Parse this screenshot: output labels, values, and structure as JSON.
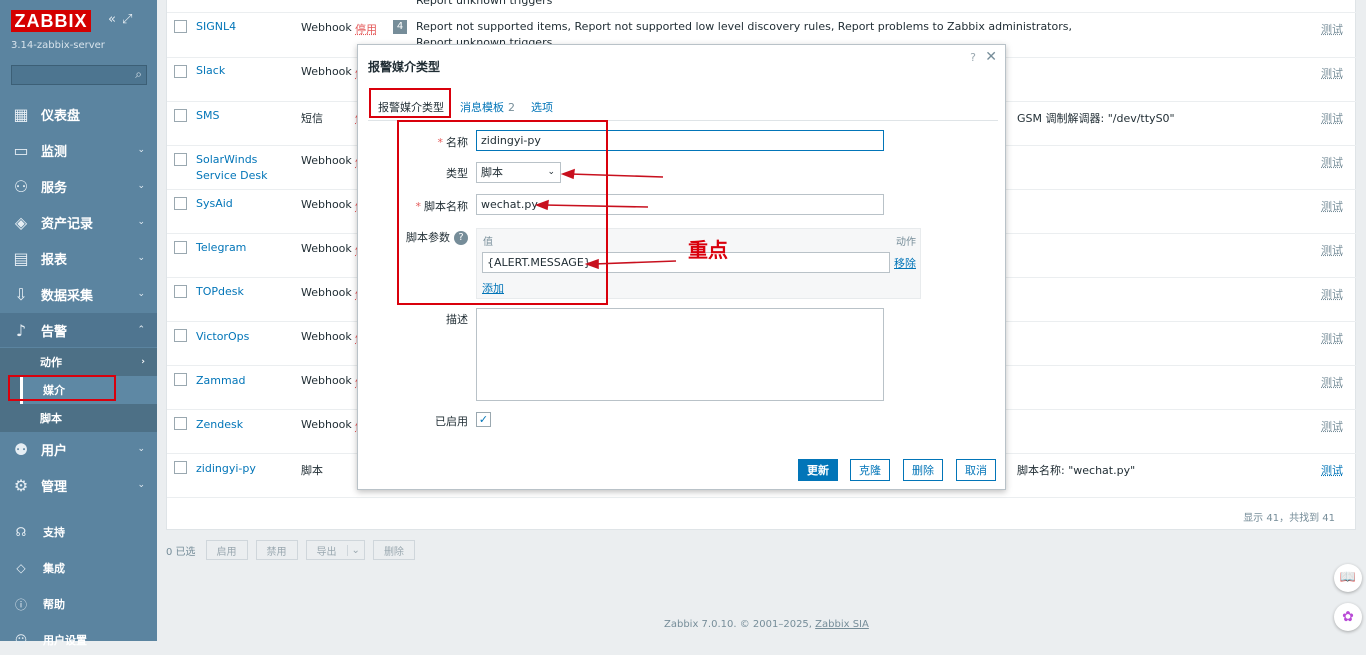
{
  "sidebar": {
    "logo": "ZABBIX",
    "server": "3.14-zabbix-server",
    "search_placeholder": "",
    "nav": [
      {
        "label": "仪表盘",
        "icon": "dashboard-icon"
      },
      {
        "label": "监测",
        "icon": "monitoring-icon"
      },
      {
        "label": "服务",
        "icon": "services-icon"
      },
      {
        "label": "资产记录",
        "icon": "inventory-icon"
      },
      {
        "label": "报表",
        "icon": "reports-icon"
      },
      {
        "label": "数据采集",
        "icon": "data-collection-icon"
      },
      {
        "label": "告警",
        "icon": "bell-icon"
      }
    ],
    "sub": [
      {
        "label": "动作"
      },
      {
        "label": "媒介"
      },
      {
        "label": "脚本"
      }
    ],
    "nav2": [
      {
        "label": "用户",
        "icon": "users-icon"
      },
      {
        "label": "管理",
        "icon": "gear-icon"
      }
    ],
    "bottom": [
      {
        "label": "支持",
        "icon": "headset-icon"
      },
      {
        "label": "集成",
        "icon": "integrations-icon"
      },
      {
        "label": "帮助",
        "icon": "help-icon"
      },
      {
        "label": "用户设置",
        "icon": "user-settings-icon"
      }
    ]
  },
  "table": {
    "top_text_line1": "Report unknown triggers",
    "rows": [
      {
        "name": "SIGNL4",
        "type": "Webhook",
        "status": "停用",
        "badge": "4",
        "actions": "Report not supported items, Report not supported low level discovery rules, Report problems to Zabbix administrators,",
        "actions2": "Report unknown triggers",
        "test": "测试",
        "details": ""
      },
      {
        "name": "Slack",
        "type": "Webhook",
        "status": "停",
        "test": "测试",
        "details": ""
      },
      {
        "name": "SMS",
        "type": "短信",
        "status": "停",
        "test": "测试",
        "details": "GSM 调制解调器: \"/dev/ttyS0\""
      },
      {
        "name": "SolarWinds Service Desk",
        "type": "Webhook",
        "status": "停",
        "test": "测试",
        "details": ""
      },
      {
        "name": "SysAid",
        "type": "Webhook",
        "status": "停",
        "test": "测试",
        "details": ""
      },
      {
        "name": "Telegram",
        "type": "Webhook",
        "status": "停",
        "test": "测试",
        "details": ""
      },
      {
        "name": "TOPdesk",
        "type": "Webhook",
        "status": "停",
        "test": "测试",
        "details": ""
      },
      {
        "name": "VictorOps",
        "type": "Webhook",
        "status": "停",
        "test": "测试",
        "details": ""
      },
      {
        "name": "Zammad",
        "type": "Webhook",
        "status": "停",
        "test": "测试",
        "details": ""
      },
      {
        "name": "Zendesk",
        "type": "Webhook",
        "status": "停",
        "test": "测试",
        "details": ""
      },
      {
        "name": "zidingyi-py",
        "type": "脚本",
        "status": "",
        "test": "测试",
        "details": "脚本名称: \"wechat.py\""
      }
    ],
    "count": "显示 41，共找到 41"
  },
  "bottombar": {
    "selected": "0 已选",
    "enable": "启用",
    "disable": "禁用",
    "export": "导出",
    "delete": "删除"
  },
  "footer": {
    "copy": "Zabbix 7.0.10. © 2001–2025, ",
    "company": "Zabbix SIA"
  },
  "modal": {
    "title": "报警媒介类型",
    "help": "?",
    "tabs": {
      "media": "报警媒介类型",
      "templates": "消息模板",
      "templates_count": "2",
      "options": "选项"
    },
    "labels": {
      "name": "名称",
      "type": "类型",
      "script": "脚本名称",
      "params": "脚本参数",
      "desc": "描述",
      "enabled": "已启用"
    },
    "values": {
      "name": "zidingyi-py",
      "type": "脚本",
      "script": "wechat.py",
      "param": "{ALERT.MESSAGE}"
    },
    "params": {
      "col_value": "值",
      "col_action": "动作",
      "remove": "移除",
      "add": "添加"
    },
    "annotation": "重点",
    "buttons": {
      "update": "更新",
      "clone": "克隆",
      "delete": "删除",
      "cancel": "取消"
    }
  }
}
